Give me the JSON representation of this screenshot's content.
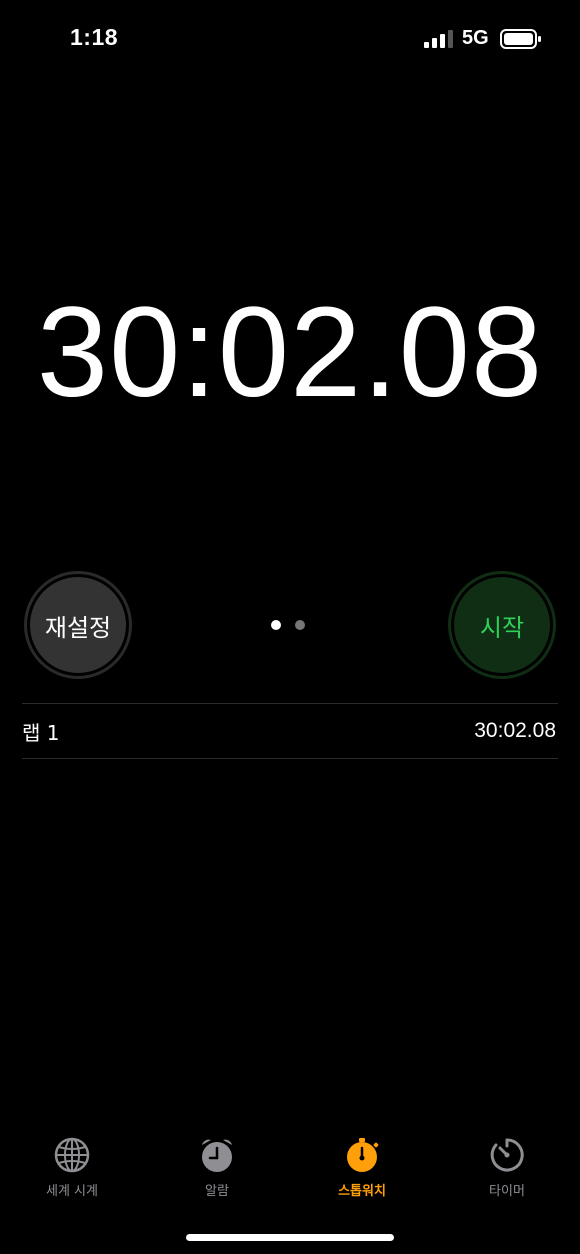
{
  "status_bar": {
    "time": "1:18",
    "network": "5G",
    "signal_bars": 4,
    "signal_bars_active": 3,
    "battery_level": 0.9
  },
  "stopwatch": {
    "display_time": "30:02.08"
  },
  "controls": {
    "reset_label": "재설정",
    "start_label": "시작",
    "page_count": 2,
    "active_page": 1
  },
  "laps": [
    {
      "label": "랩 1",
      "time": "30:02.08"
    }
  ],
  "tabs": [
    {
      "label": "세계 시계",
      "icon": "globe-icon",
      "active": false
    },
    {
      "label": "알람",
      "icon": "alarm-clock-icon",
      "active": false
    },
    {
      "label": "스톱워치",
      "icon": "stopwatch-icon",
      "active": true
    },
    {
      "label": "타이머",
      "icon": "timer-icon",
      "active": false
    }
  ],
  "colors": {
    "accent": "#ff9f0a",
    "start_text": "#30d158",
    "inactive_tab": "#8e8e93"
  }
}
